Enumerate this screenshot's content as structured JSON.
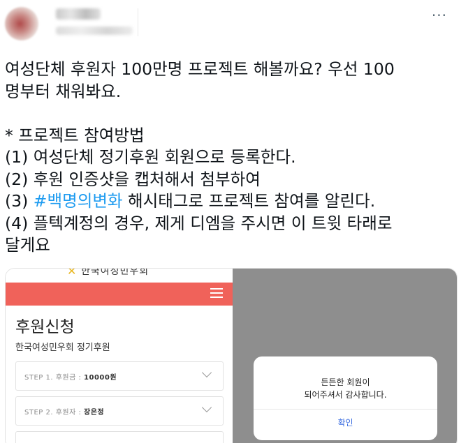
{
  "tweet": {
    "more_label": "···",
    "text_lines": [
      "여성단체 후원자 100만명 프로젝트 해볼까요? 우선 100",
      "명부터 채워봐요.",
      "* 프로젝트 참여방법",
      "(1) 여성단체 정기후원 회원으로 등록한다.",
      "(2) 후원 인증샷을 캡처해서 첨부하여",
      "(3) ",
      "#백명의변화",
      " 해시태그로 프로젝트 참여를 알린다.",
      "(4) 플텍계정의 경우, 제게 디엠을 주시면 이 트윗 타래로",
      "달게요"
    ]
  },
  "media": {
    "logo_text": "한국여성민우회",
    "form_title": "후원신청",
    "form_subtitle": "한국여성민우회 정기후원",
    "steps": [
      {
        "prefix": "STEP 1. 후원금 : ",
        "value": "10000원"
      },
      {
        "prefix": "STEP 2. 후원자 : ",
        "value": "장은정"
      }
    ],
    "dialog": {
      "line1": "든든한 회원이",
      "line2": "되어주셔서 감사합니다.",
      "confirm": "확인"
    }
  },
  "colors": {
    "hashtag": "#1d9bf0",
    "header_bar": "#f0625a",
    "overlay": "#8e8e8e",
    "confirm": "#3b6de0"
  }
}
